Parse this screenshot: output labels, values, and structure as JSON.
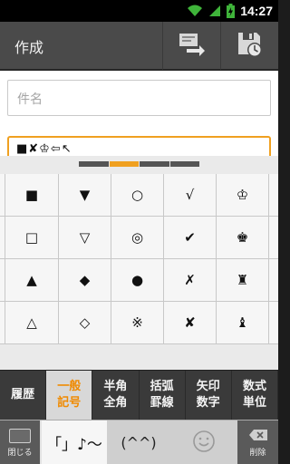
{
  "status_bar": {
    "time": "14:27"
  },
  "action_bar": {
    "title": "作成",
    "buttons": [
      {
        "icon": "send-icon"
      },
      {
        "icon": "save-draft-icon"
      }
    ]
  },
  "compose": {
    "subject_placeholder": "件名",
    "body_text": "■✘♔⇦↖"
  },
  "keyboard": {
    "page_indicator": {
      "count": 4,
      "active_index": 1
    },
    "symbols": [
      [
        "■",
        "▼",
        "○",
        "√",
        "♔"
      ],
      [
        "□",
        "▽",
        "◎",
        "✔",
        "♚"
      ],
      [
        "▲",
        "◆",
        "●",
        "✗",
        "♜"
      ],
      [
        "△",
        "◇",
        "※",
        "✘",
        "♝"
      ]
    ],
    "categories": [
      {
        "label": "履歴",
        "active": false
      },
      {
        "label": "一般\n記号",
        "active": true
      },
      {
        "label": "半角\n全角",
        "active": false
      },
      {
        "label": "括弧\n罫線",
        "active": false
      },
      {
        "label": "矢印\n数字",
        "active": false
      },
      {
        "label": "数式\n単位",
        "active": false
      }
    ],
    "bottom": {
      "close_label": "閉じる",
      "tab1_label": "「」♪〜",
      "tab2_label": "(^^)",
      "tab3_icon": "smiley-icon",
      "delete_label": "削除"
    },
    "accent_color": "#f0a020"
  }
}
